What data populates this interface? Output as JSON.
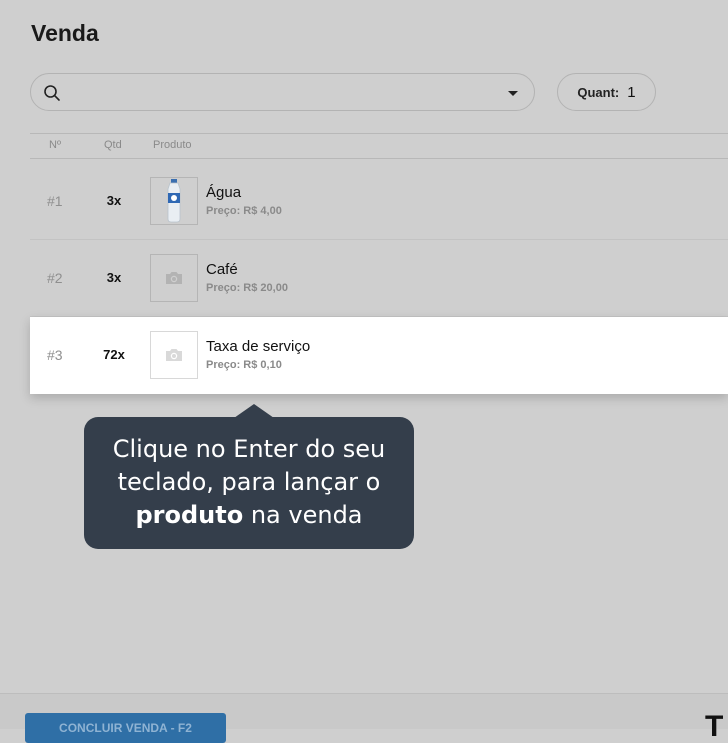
{
  "page": {
    "title": "Venda"
  },
  "search": {
    "value": "",
    "placeholder": ""
  },
  "quantity": {
    "label": "Quant:",
    "value": "1"
  },
  "table": {
    "headers": {
      "num": "Nº",
      "qty": "Qtd",
      "product": "Produto"
    },
    "rows": [
      {
        "num": "#1",
        "qty": "3x",
        "name": "Água",
        "price": "Preço: R$ 4,00",
        "image": "water-bottle"
      },
      {
        "num": "#2",
        "qty": "3x",
        "name": "Café",
        "price": "Preço: R$ 20,00",
        "image": "camera-placeholder"
      },
      {
        "num": "#3",
        "qty": "72x",
        "name": "Taxa de serviço",
        "price": "Preço: R$ 0,10",
        "image": "camera-placeholder"
      }
    ]
  },
  "tooltip": {
    "line1": "Clique no Enter do seu",
    "line2": "teclado, para lançar o",
    "bold": "produto",
    "tail": " na venda"
  },
  "footer": {
    "conclude_label": "CONCLUIR VENDA - F2",
    "total_glyph": "T"
  },
  "colors": {
    "overlay": "#cfcfcf",
    "tooltip_bg": "#343e4b",
    "primary": "#2f6fa6"
  }
}
